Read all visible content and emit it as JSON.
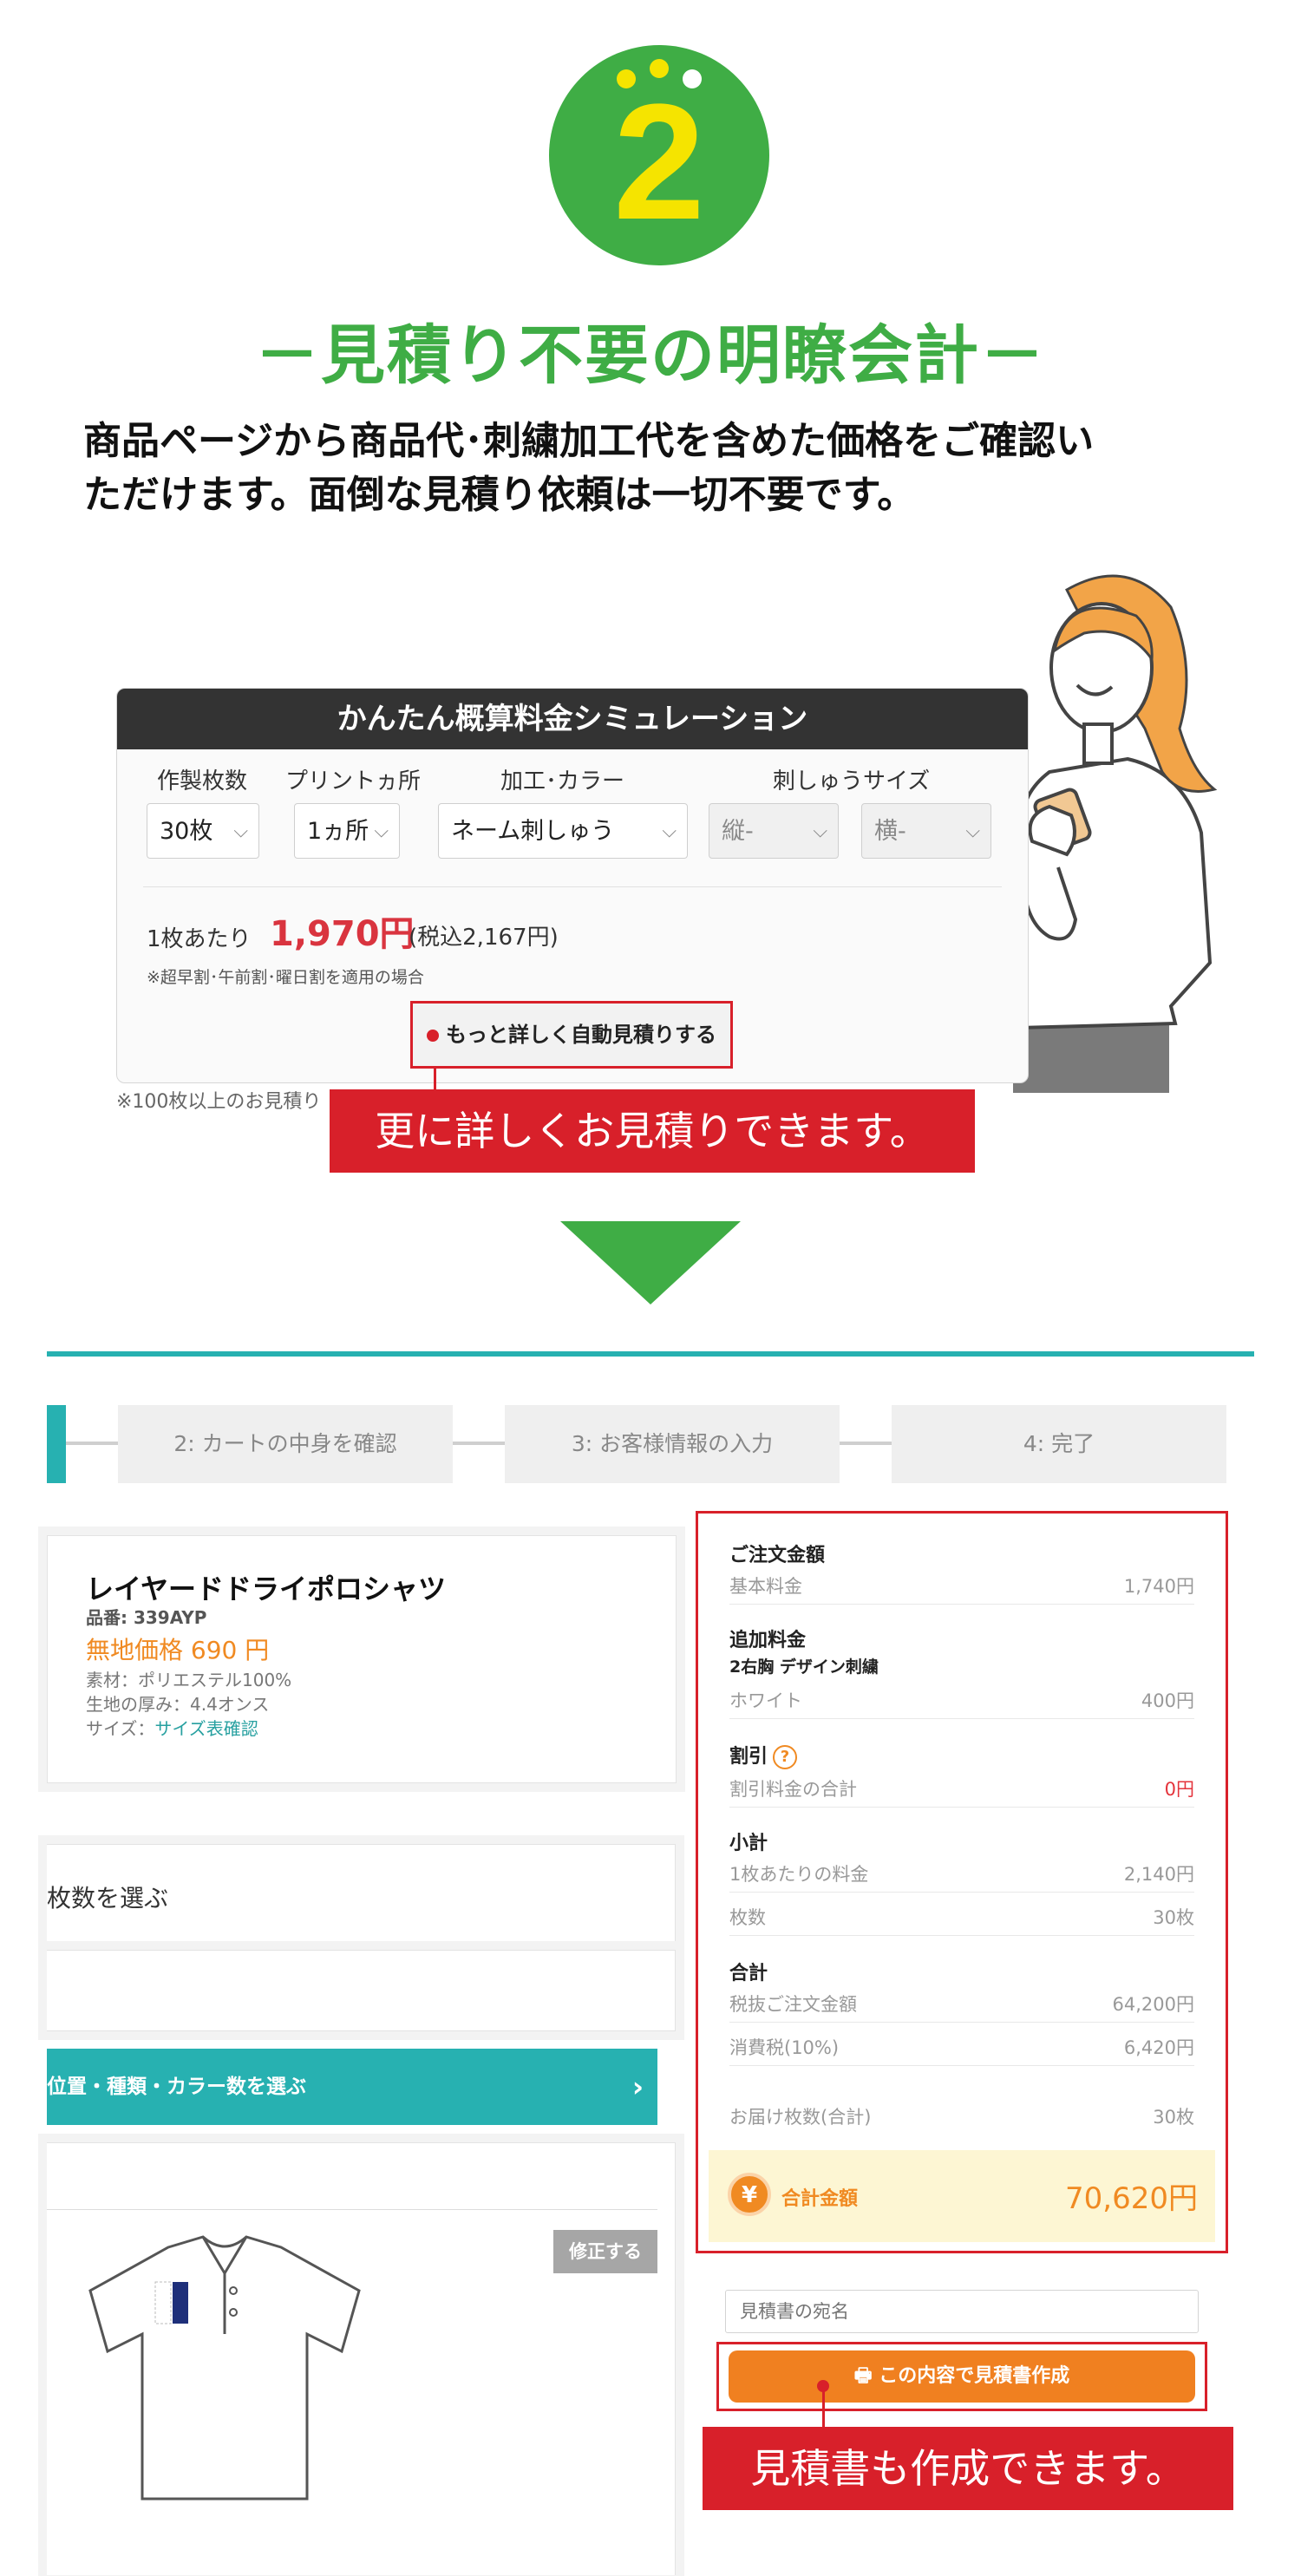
{
  "intro": {
    "step_number": "2",
    "heading": "－見積り不要の明瞭会計－",
    "subcopy_line1": "商品ページから商品代･刺繍加工代を含めた価格をご確認い",
    "subcopy_line2": "ただけます。面倒な見積り依頼は一切不要です。"
  },
  "simulator": {
    "title": "かんたん概算料金シミュレーション",
    "labels": [
      "作製枚数",
      "プリントヵ所",
      "加工･カラー",
      "刺しゅうサイズ"
    ],
    "selects": {
      "quantity": "30枚",
      "print_locations": "1ヵ所",
      "process_color": "ネーム刺しゅう",
      "size_vertical": "縦-",
      "size_horizontal": "横-"
    },
    "per_unit_label": "1枚あたり",
    "per_unit_price": "1,970円",
    "per_unit_tax": "(税込2,167円)",
    "note": "※超早割･午前割･曜日割を適用の場合",
    "auto_estimate_button": "もっと詳しく自動見積りする",
    "bulk_note": "※100枚以上のお見積り",
    "callout": "更に詳しくお見積りできます。"
  },
  "steps": [
    "2: カートの中身を確認",
    "3: お客様情報の入力",
    "4: 完了"
  ],
  "product": {
    "name": "レイヤードドライポロシャツ",
    "code": "品番: 339AYP",
    "price": "無地価格 690 円",
    "material": "素材：ポリエステル100%",
    "thickness": "生地の厚み：4.4オンス",
    "size_label": "サイズ：",
    "size_link": "サイズ表確認"
  },
  "left_panels": {
    "quantity_title": "枚数を選ぶ",
    "position_button": "位置・種類・カラー数を選ぶ",
    "edit_button": "修正する"
  },
  "order": {
    "order_amount_header": "ご注文金額",
    "base_fee_label": "基本料金",
    "base_fee_value": "1,740円",
    "additional_header": "追加料金",
    "additional_item": "2右胸 デザイン刺繍",
    "white_label": "ホワイト",
    "white_value": "400円",
    "discount_header": "割引",
    "discount_total_label": "割引料金の合計",
    "discount_total_value": "0円",
    "subtotal_header": "小計",
    "per_unit_label": "1枚あたりの料金",
    "per_unit_value": "2,140円",
    "count_label": "枚数",
    "count_value": "30枚",
    "total_header": "合計",
    "pretax_label": "税抜ご注文金額",
    "pretax_value": "64,200円",
    "tax_label": "消費税(10%)",
    "tax_value": "6,420円",
    "delivery_label": "お届け枚数(合計)",
    "delivery_value": "30枚",
    "grand_total_label": "合計金額",
    "grand_total_value": "70,620円"
  },
  "quote": {
    "addressee_placeholder": "見積書の宛名",
    "create_button": "この内容で見積書作成",
    "callout": "見積書も作成できます。"
  },
  "colors": {
    "brand_green": "#3fad45",
    "accent_red": "#d8202a",
    "teal": "#27b1b1",
    "orange": "#f08a22"
  }
}
